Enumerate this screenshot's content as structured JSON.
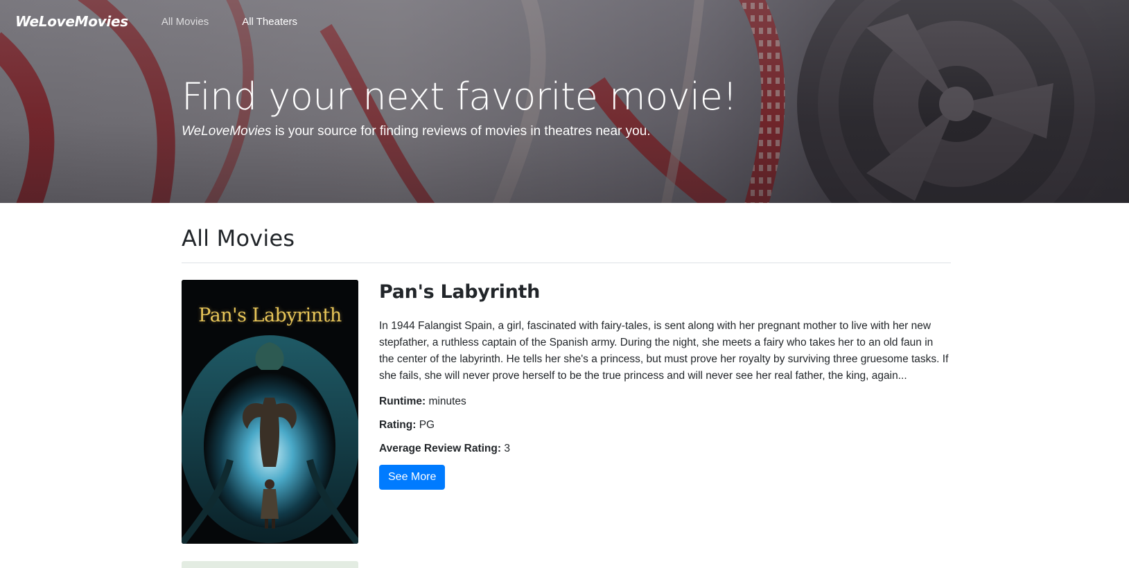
{
  "navbar": {
    "brand": "WeLoveMovies",
    "links": [
      {
        "label": "All Movies"
      },
      {
        "label": "All Theaters"
      }
    ]
  },
  "hero": {
    "title": "Find your next favorite movie!",
    "subtitle_brand": "WeLoveMovies",
    "subtitle_rest": " is your source for finding reviews of movies in theatres near you."
  },
  "main": {
    "section_title": "All Movies",
    "movies": [
      {
        "poster_text": "Pan's Labyrinth",
        "title": "Pan's Labyrinth",
        "description": "In 1944 Falangist Spain, a girl, fascinated with fairy-tales, is sent along with her pregnant mother to live with her new stepfather, a ruthless captain of the Spanish army. During the night, she meets a fairy who takes her to an old faun in the center of the labyrinth. He tells her she's a princess, but must prove her royalty by surviving three gruesome tasks. If she fails, she will never prove herself to be the true princess and will never see her real father, the king, again...",
        "runtime_label": "Runtime:",
        "runtime_value": " minutes",
        "rating_label": "Rating:",
        "rating_value": " PG",
        "avg_label": "Average Review Rating:",
        "avg_value": " 3",
        "button": "See More"
      }
    ]
  }
}
